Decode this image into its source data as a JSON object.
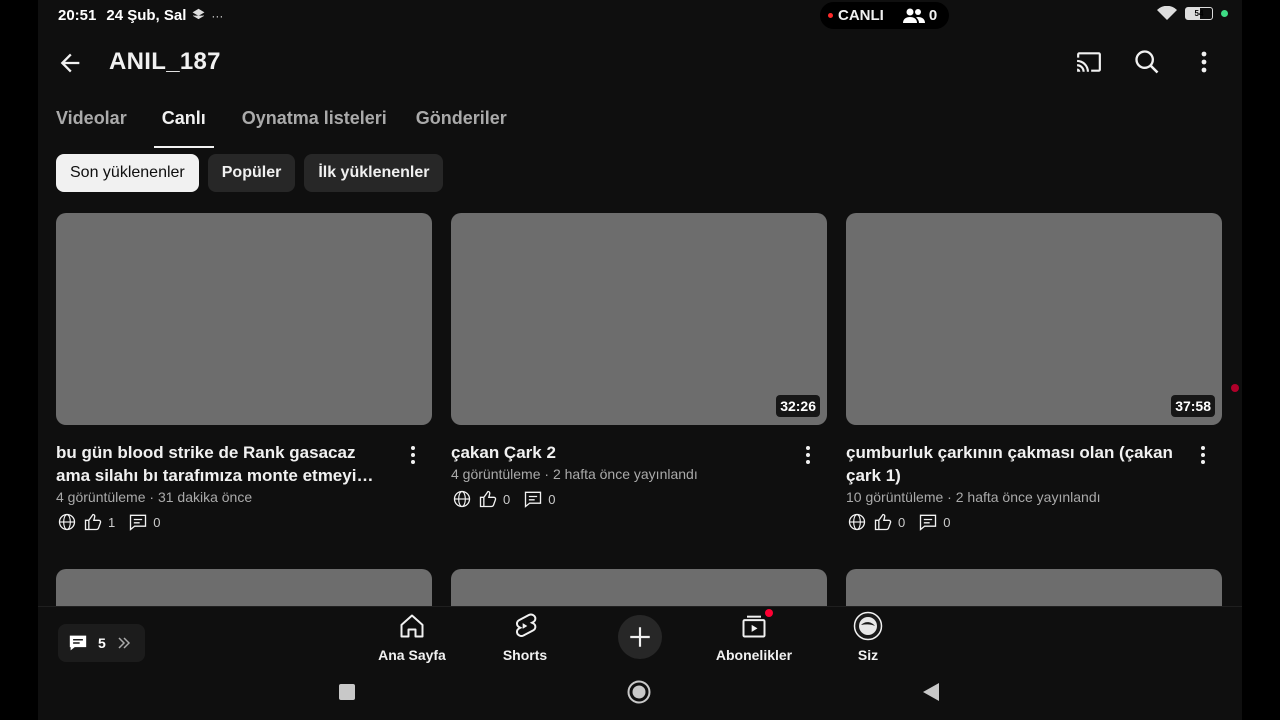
{
  "status_bar": {
    "time": "20:51",
    "date": "24 Şub, Sal",
    "live_label": "CANLI",
    "viewer_count": "0",
    "battery": "54"
  },
  "app_bar": {
    "title": "ANIL_187",
    "icons": [
      "back-arrow-icon",
      "cast-icon",
      "search-icon",
      "more-vert-icon"
    ]
  },
  "tabs": [
    {
      "label": "Videolar",
      "active": false
    },
    {
      "label": "Canlı",
      "active": true
    },
    {
      "label": "Oynatma listeleri",
      "active": false
    },
    {
      "label": "Gönderiler",
      "active": false
    }
  ],
  "chips": [
    {
      "label": "Son yüklenenler",
      "active": true
    },
    {
      "label": "Popüler",
      "active": false
    },
    {
      "label": "İlk yüklenenler",
      "active": false
    }
  ],
  "videos": [
    {
      "title": "bu gün blood strike de Rank gasacaz ama silahı bı tarafımıza monte etmeyi düşünüyoruz",
      "meta": "4 görüntüleme · 31 dakika önce",
      "duration": "",
      "likes": "1",
      "comments": "0"
    },
    {
      "title": "çakan Çark 2",
      "meta": "4 görüntüleme · 2 hafta önce yayınlandı",
      "duration": "32:26",
      "likes": "0",
      "comments": "0"
    },
    {
      "title": "çumburluk çarkının çakması olan (çakan çark 1)",
      "meta": "10 görüntüleme · 2 hafta önce yayınlandı",
      "duration": "37:58",
      "likes": "0",
      "comments": "0"
    }
  ],
  "bottom_nav": [
    {
      "label": "Ana Sayfa",
      "icon": "home-icon"
    },
    {
      "label": "Shorts",
      "icon": "shorts-icon"
    },
    {
      "label": "",
      "icon": "plus-icon"
    },
    {
      "label": "Abonelikler",
      "icon": "subscriptions-icon"
    },
    {
      "label": "Siz",
      "icon": "avatar-icon"
    }
  ],
  "chat_overlay": {
    "count": "5"
  },
  "colors": {
    "background": "#0f0f0f",
    "thumbnail": "#6d6d6d",
    "chip": "#272727",
    "live_dot": "#ff2a2a"
  }
}
